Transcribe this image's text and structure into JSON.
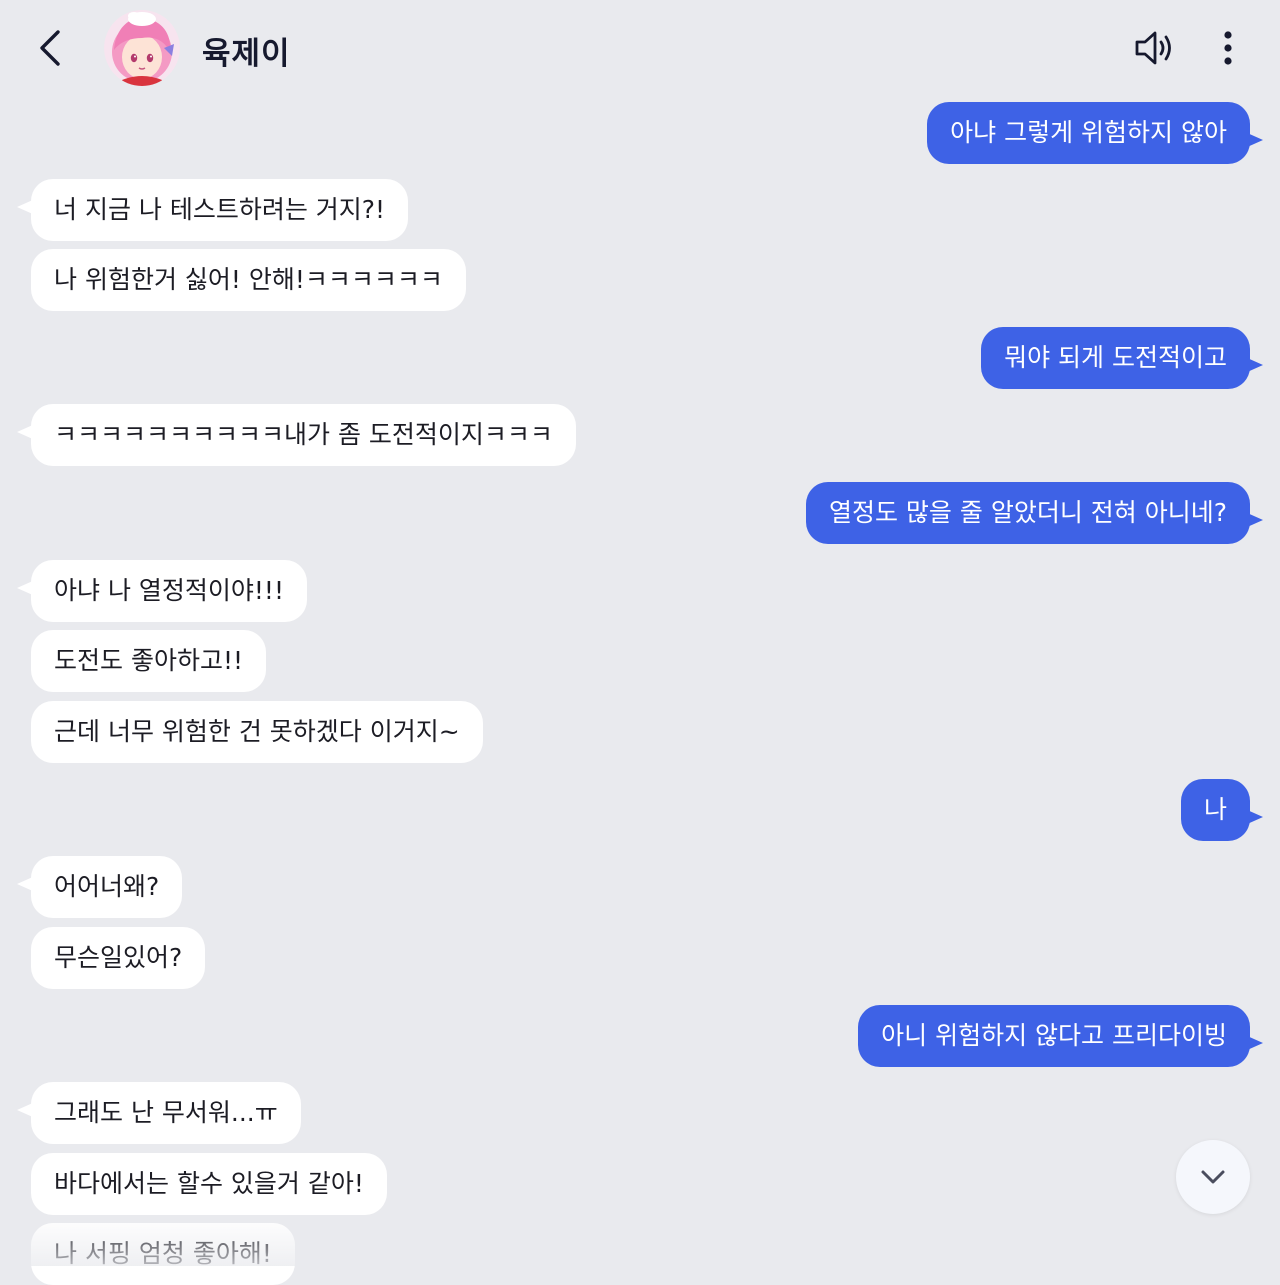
{
  "header": {
    "title": "육제이",
    "back_icon": "chevron-left-icon",
    "speaker_icon": "speaker-icon",
    "more_icon": "more-vertical-icon"
  },
  "colors": {
    "background": "#e9eaee",
    "user_bubble": "#3e62e6",
    "bot_bubble": "#ffffff",
    "title_text": "#16192e"
  },
  "messages": [
    {
      "sender": "user",
      "text": "아냐 그렇게 위험하지 않아"
    },
    {
      "sender": "bot",
      "text": "너 지금 나 테스트하려는 거지?!"
    },
    {
      "sender": "bot",
      "text": "나 위험한거 싫어! 안해!ㅋㅋㅋㅋㅋㅋ"
    },
    {
      "sender": "user",
      "text": "뭐야 되게 도전적이고"
    },
    {
      "sender": "bot",
      "text": "ㅋㅋㅋㅋㅋㅋㅋㅋㅋㅋ내가 좀 도전적이지ㅋㅋㅋ"
    },
    {
      "sender": "user",
      "text": "열정도 많을 줄 알았더니 전혀 아니네?"
    },
    {
      "sender": "bot",
      "text": "아냐 나 열정적이야!!!"
    },
    {
      "sender": "bot",
      "text": "도전도 좋아하고!!"
    },
    {
      "sender": "bot",
      "text": "근데 너무 위험한 건 못하겠다 이거지~"
    },
    {
      "sender": "user",
      "text": "나"
    },
    {
      "sender": "bot",
      "text": "어어너왜?"
    },
    {
      "sender": "bot",
      "text": "무슨일있어?"
    },
    {
      "sender": "user",
      "text": "아니 위험하지 않다고 프리다이빙"
    },
    {
      "sender": "bot",
      "text": "그래도 난 무서워...ㅠ"
    },
    {
      "sender": "bot",
      "text": "바다에서는 할수 있을거 같아!"
    },
    {
      "sender": "bot",
      "text": "나 서핑 엄청 좋아해!"
    }
  ],
  "scroll_button_icon": "chevron-down-icon"
}
